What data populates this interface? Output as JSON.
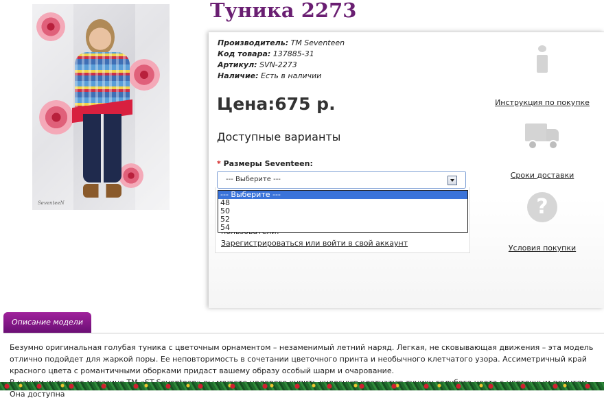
{
  "product": {
    "title": "Туника 2273",
    "photo_signature": "SeventeeN"
  },
  "specs": {
    "manufacturer_label": "Производитель:",
    "manufacturer_value": "ТМ Seventeen",
    "code_label": "Код товара:",
    "code_value": "137885-31",
    "article_label": "Артикул:",
    "article_value": "SVN-2273",
    "availability_label": "Наличие:",
    "availability_value": "Есть в наличии"
  },
  "price": {
    "label": "Цена:",
    "value": "675 р."
  },
  "variants": {
    "title": "Доступные варианты",
    "required_mark": "*",
    "size_label": "Размеры Seventeen:",
    "select_value": "--- Выберите ---",
    "options": [
      "--- Выберите ---",
      "48",
      "50",
      "52",
      "54"
    ]
  },
  "notice": {
    "partial_text": "пользователи!",
    "register_link": "Зарегистрироваться или войти в свой аккаунт"
  },
  "side_links": {
    "instruction": "Инструкция по покупке",
    "delivery": "Сроки доставки",
    "conditions": "Условия покупки"
  },
  "description": {
    "tab_label": "Описание модели",
    "paragraph1": "Безумно оригинальная голубая туника с цветочным орнаментом – незаменимый летний наряд. Легкая, не сковывающая движения – эта модель отлично подойдет для жаркой поры. Ее неповторимость в сочетании цветочного принта и необычного клетчатого узора. Ассиметричный край красного цвета с романтичными оборками придаст вашему образу особый шарм и очарование.",
    "paragraph2": "В нашем интернет-магазине ТМ «ST-Seventeen» вы можете недорого купить чудесную клетчатую тунику голубого цвета с цветочным принтом. Она доступна"
  },
  "colors": {
    "title": "#6a1f72",
    "tab": "#8a1a8a",
    "required": "#d21f1f",
    "selected_option": "#3a73d9"
  }
}
